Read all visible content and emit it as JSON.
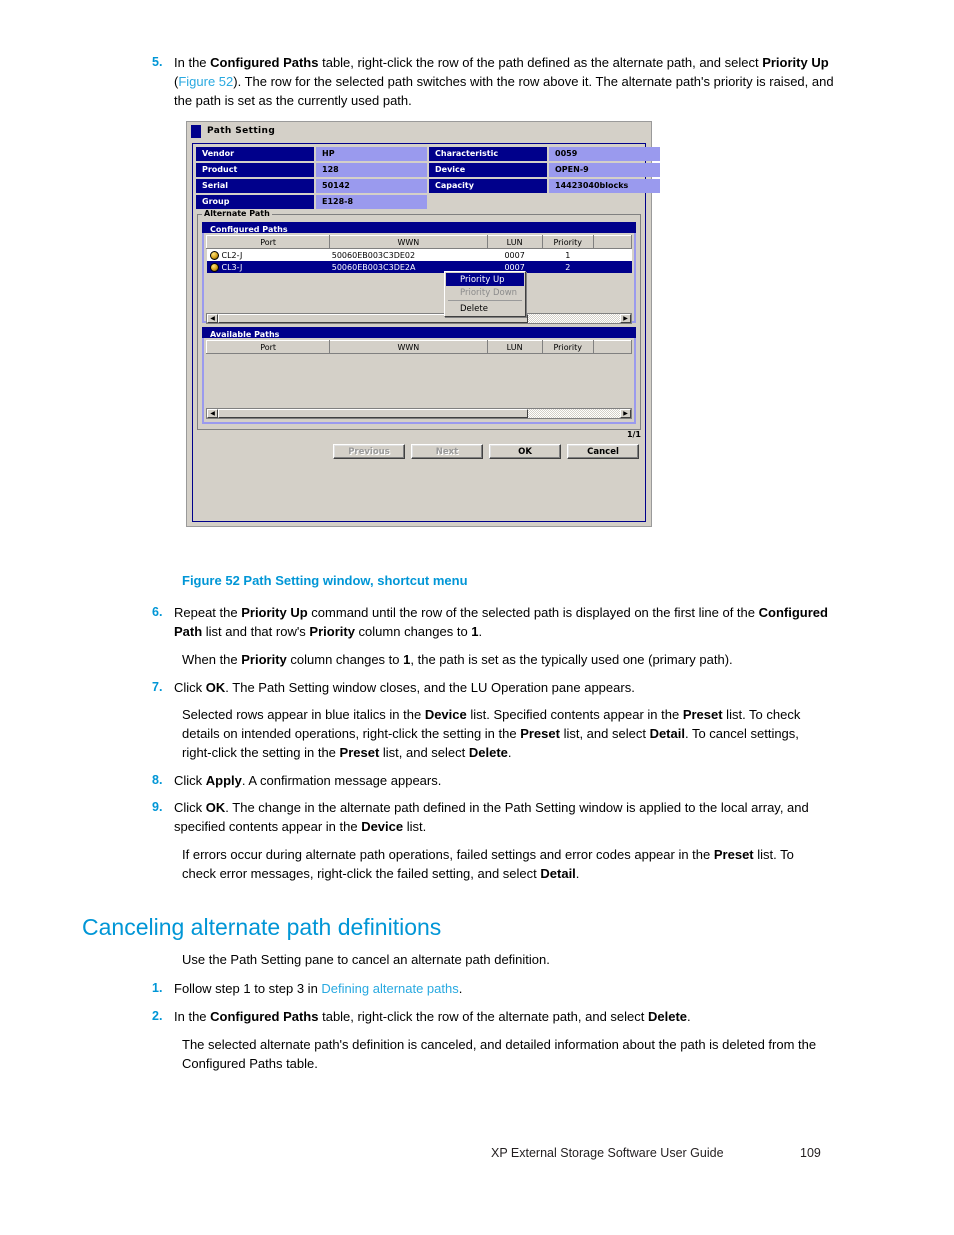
{
  "page": {
    "footer_title": "XP External Storage Software User Guide",
    "footer_page": "109"
  },
  "steps": {
    "s5": {
      "num": "5.",
      "html": "In the <b>Configured Paths</b> table, right-click the row of the path defined as the alternate path, and select <b>Priority Up</b> (<span class=\"lnk\">Figure 52</span>). The row for the selected path switches with the row above it. The alternate path's priority is raised, and the path is set as the currently used path."
    },
    "s6": {
      "num": "6.",
      "html": "Repeat the <b>Priority Up</b> command until the row of the selected path is displayed on the first line of the <b>Configured Path</b> list and that row's <b>Priority</b> column changes to <b>1</b>."
    },
    "s6_note": {
      "html": "When the <b>Priority</b> column changes to <b>1</b>, the path is set as the typically used one (primary path)."
    },
    "s7": {
      "num": "7.",
      "html": "Click <b>OK</b>. The Path Setting window closes, and the LU Operation pane appears."
    },
    "s7_note": {
      "html": "Selected rows appear in blue italics in the <b>Device</b> list. Specified contents appear in the <b>Preset</b> list. To check details on intended operations, right-click the setting in the <b>Preset</b> list, and select <b>Detail</b>. To cancel settings, right-click the setting in the <b>Preset</b> list, and select <b>Delete</b>."
    },
    "s8": {
      "num": "8.",
      "html": "Click <b>Apply</b>. A confirmation message appears."
    },
    "s9": {
      "num": "9.",
      "html": "Click <b>OK</b>. The change in the alternate path defined in the Path Setting window is applied to the local array, and specified contents appear in the <b>Device</b> list."
    },
    "s9_note": {
      "html": "If errors occur during alternate path operations, failed settings and error codes appear in the <b>Preset</b> list. To check error messages, right-click the failed setting, and select <b>Detail</b>."
    }
  },
  "figure": {
    "caption": "Figure 52 Path Setting window, shortcut menu"
  },
  "section": {
    "heading": "Canceling alternate path definitions",
    "intro": "Use the Path Setting pane to cancel an alternate path definition.",
    "c1": {
      "num": "1.",
      "html": "Follow step 1 to step 3 in <span class=\"lnk\">Defining alternate paths</span>."
    },
    "c2": {
      "num": "2.",
      "html": "In the <b>Configured Paths</b> table, right-click the row of the alternate path, and select <b>Delete</b>."
    },
    "c2_note": {
      "html": "The selected alternate path's definition is canceled, and detailed information about the path is deleted from the Configured Paths table."
    }
  },
  "screenshot": {
    "window_title": "Path Setting",
    "info": {
      "rows": [
        {
          "label_left": "Vendor",
          "value_left": "HP",
          "label_right": "Characteristic",
          "value_right": "0059"
        },
        {
          "label_left": "Product",
          "value_left": "128",
          "label_right": "Device",
          "value_right": "OPEN-9"
        },
        {
          "label_left": "Serial",
          "value_left": "50142",
          "label_right": "Capacity",
          "value_right": "14423040blocks"
        },
        {
          "label_left": "Group",
          "value_left": "E128-8",
          "label_right": "",
          "value_right": ""
        }
      ]
    },
    "alternate_path": {
      "legend": "Alternate Path",
      "configured": {
        "header": "Configured Paths",
        "columns": [
          "Port",
          "WWN",
          "LUN",
          "Priority",
          ""
        ],
        "rows": [
          {
            "port": "CL2-J",
            "wwn": "50060EB003C3DE02",
            "lun": "0007",
            "priority": "1",
            "selected": false
          },
          {
            "port": "CL3-J",
            "wwn": "50060EB003C3DE2A",
            "lun": "0007",
            "priority": "2",
            "selected": true
          }
        ]
      },
      "available": {
        "header": "Available Paths",
        "columns": [
          "Port",
          "WWN",
          "LUN",
          "Priority",
          ""
        ],
        "rows": []
      }
    },
    "context_menu": {
      "items": [
        {
          "label": "Priority Up",
          "state": "highlighted"
        },
        {
          "label": "Priority Down",
          "state": "disabled"
        },
        {
          "label": "Delete",
          "state": "normal"
        }
      ]
    },
    "page_count": "1/1",
    "buttons": [
      {
        "label": "Previous",
        "disabled": true
      },
      {
        "label": "Next",
        "disabled": true
      },
      {
        "label": "OK",
        "disabled": false
      },
      {
        "label": "Cancel",
        "disabled": false
      }
    ]
  },
  "colors": {
    "accent_blue": "#0096d6",
    "link_blue": "#29a9e0",
    "win_navy": "#00008b",
    "win_value": "#9a9aee",
    "win_face": "#d4d0c8"
  }
}
